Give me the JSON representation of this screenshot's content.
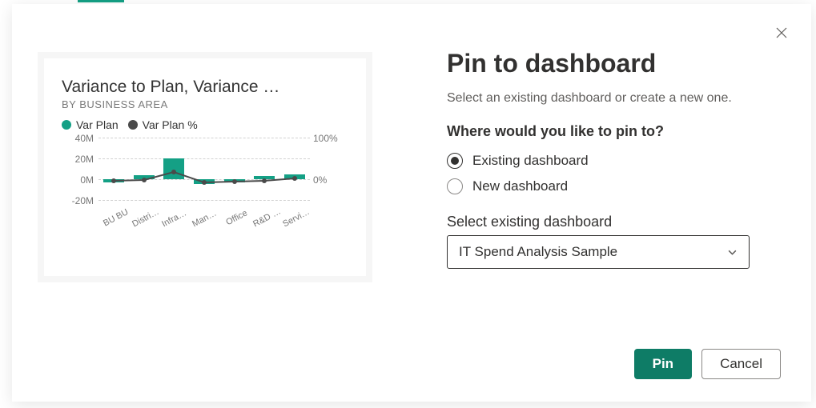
{
  "dialog": {
    "title": "Pin to dashboard",
    "subtitle": "Select an existing dashboard or create a new one.",
    "prompt": "Where would you like to pin to?",
    "radios": {
      "existing": "Existing dashboard",
      "new": "New dashboard"
    },
    "select_label": "Select existing dashboard",
    "select_value": "IT Spend Analysis Sample",
    "buttons": {
      "primary": "Pin",
      "secondary": "Cancel"
    }
  },
  "chart": {
    "title": "Variance to Plan, Variance …",
    "subtitle": "BY BUSINESS AREA",
    "legend": {
      "series1": "Var Plan",
      "series2": "Var Plan %"
    },
    "y_left_ticks": [
      "40M",
      "20M",
      "0M",
      "-20M"
    ],
    "y_right_ticks": [
      "100%",
      "0%"
    ],
    "categories": [
      "BU BU",
      "Distrib…",
      "Infrastr…",
      "Manuf…",
      "Office",
      "R&D R…",
      "Service…"
    ]
  },
  "chart_data": {
    "type": "bar_line_combo",
    "title": "Variance to Plan, Variance …",
    "subtitle": "BY BUSINESS AREA",
    "categories": [
      "BU",
      "Distribution",
      "Infrastructure",
      "Manufacturing",
      "Office",
      "R&D",
      "Services"
    ],
    "series": [
      {
        "name": "Var Plan",
        "type": "bar",
        "axis": "left",
        "values": [
          -3000000,
          4000000,
          20000000,
          -5000000,
          -3000000,
          3000000,
          5000000
        ]
      },
      {
        "name": "Var Plan %",
        "type": "line",
        "axis": "right",
        "values": [
          -5,
          -2,
          18,
          -8,
          -6,
          -3,
          2
        ]
      }
    ],
    "y_left": {
      "label": "",
      "ticks": [
        -20000000,
        0,
        20000000,
        40000000
      ],
      "format": "M"
    },
    "y_right": {
      "label": "",
      "ticks": [
        0,
        100
      ],
      "format": "%"
    },
    "legend_position": "top-left"
  }
}
